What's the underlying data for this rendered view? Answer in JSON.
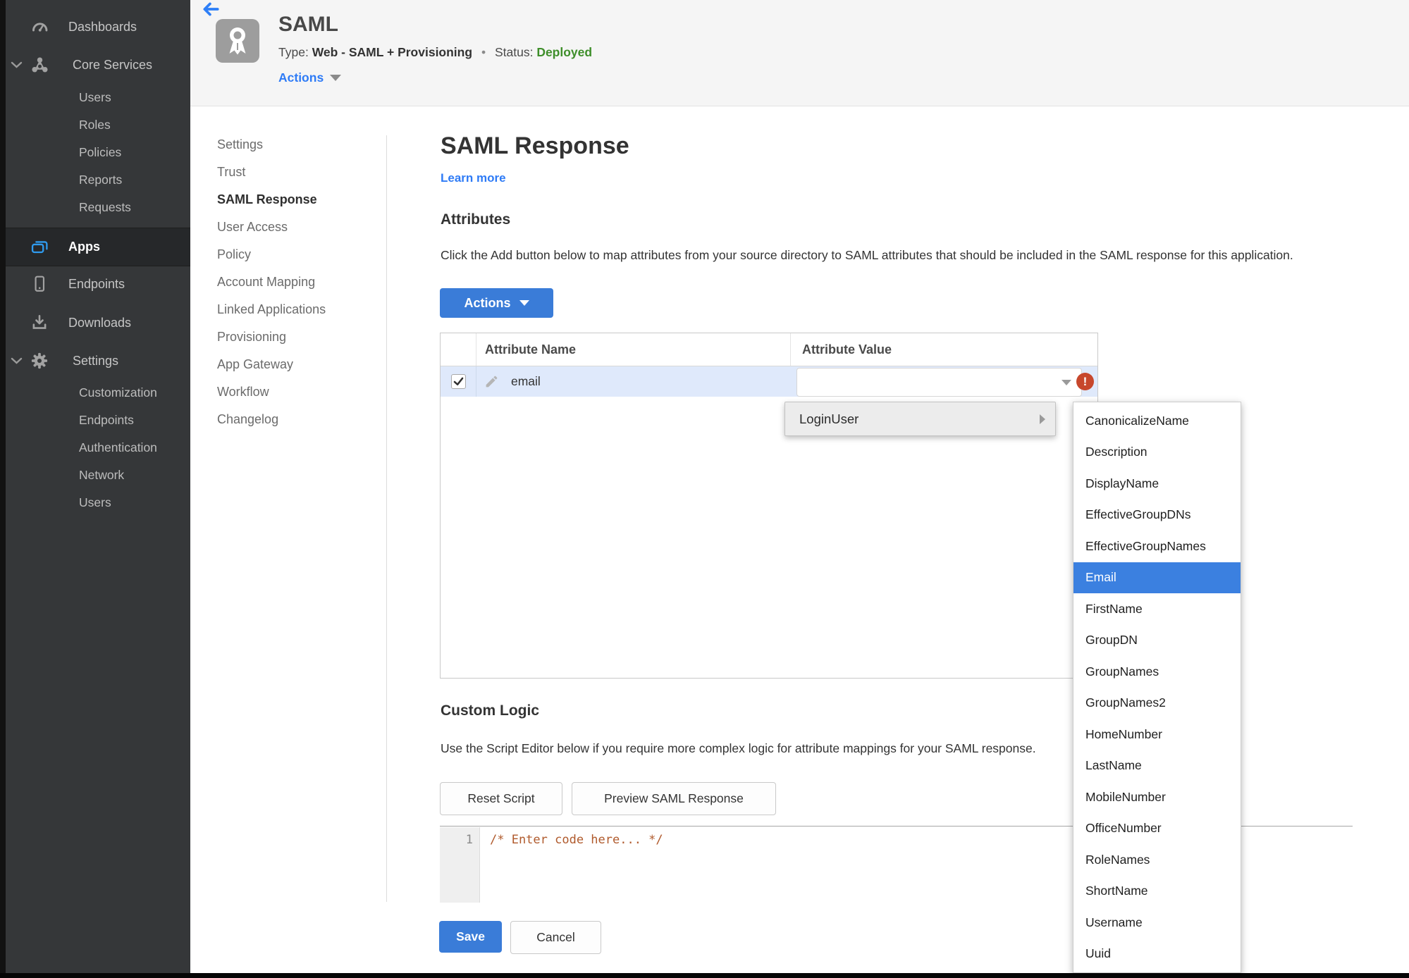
{
  "sidebar": {
    "dashboards": "Dashboards",
    "core_services": "Core Services",
    "core_sub": [
      "Users",
      "Roles",
      "Policies",
      "Reports",
      "Requests"
    ],
    "apps": "Apps",
    "endpoints": "Endpoints",
    "downloads": "Downloads",
    "settings": "Settings",
    "settings_sub": [
      "Customization",
      "Endpoints",
      "Authentication",
      "Network",
      "Users"
    ]
  },
  "header": {
    "title": "SAML",
    "type_label": "Type:",
    "type_value": "Web - SAML + Provisioning",
    "dot": "•",
    "status_label": "Status:",
    "status_value": "Deployed",
    "actions_label": "Actions"
  },
  "subnav": {
    "items": [
      "Settings",
      "Trust",
      "SAML Response",
      "User Access",
      "Policy",
      "Account Mapping",
      "Linked Applications",
      "Provisioning",
      "App Gateway",
      "Workflow",
      "Changelog"
    ],
    "active": "SAML Response"
  },
  "page": {
    "title": "SAML Response",
    "learn_more": "Learn more"
  },
  "attributes": {
    "heading": "Attributes",
    "description": "Click the Add button below to map attributes from your source directory to SAML attributes that should be included in the SAML response for this application.",
    "actions_button": "Actions",
    "columns": [
      "Attribute Name",
      "Attribute Value"
    ],
    "row": {
      "name": "email",
      "value": "",
      "checked": true,
      "error": true
    }
  },
  "value_menu": {
    "group_label": "LoginUser",
    "selected": "Email",
    "options": [
      "CanonicalizeName",
      "Description",
      "DisplayName",
      "EffectiveGroupDNs",
      "EffectiveGroupNames",
      "Email",
      "FirstName",
      "GroupDN",
      "GroupNames",
      "GroupNames2",
      "HomeNumber",
      "LastName",
      "MobileNumber",
      "OfficeNumber",
      "RoleNames",
      "ShortName",
      "Username",
      "Uuid"
    ]
  },
  "custom_logic": {
    "heading": "Custom Logic",
    "description": "Use the Script Editor below if you require more complex logic for attribute mappings for your SAML response.",
    "reset_button": "Reset Script",
    "preview_button": "Preview SAML Response",
    "editor_line_number": "1",
    "editor_code": "/* Enter code here... */"
  },
  "footer": {
    "save_button": "Save",
    "cancel_button": "Cancel"
  },
  "colors": {
    "accent_blue": "#3a7cd8",
    "link_blue": "#2e7bf6",
    "status_green": "#3e8e2a",
    "error_red": "#c7472c",
    "row_highlight": "#dfe9fb",
    "menu_selected_blue": "#3b80e0",
    "sidebar_bg": "#353739",
    "code_comment": "#b05a2c"
  }
}
